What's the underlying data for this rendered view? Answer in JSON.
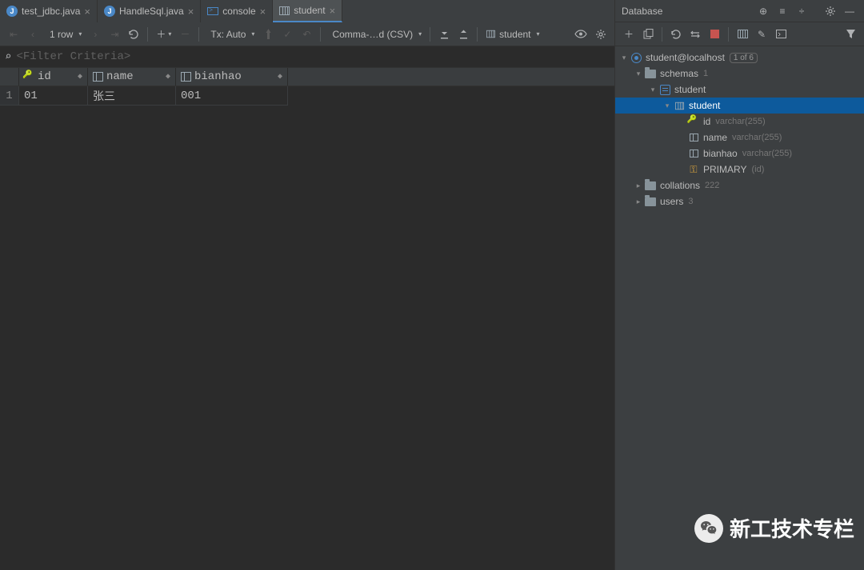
{
  "tabs": [
    {
      "label": "test_jdbc.java",
      "icon": "java"
    },
    {
      "label": "HandleSql.java",
      "icon": "java"
    },
    {
      "label": "console",
      "icon": "console"
    },
    {
      "label": "student",
      "icon": "table",
      "active": true
    }
  ],
  "toolbar": {
    "row_count": "1 row",
    "tx_mode": "Tx: Auto",
    "csv_mode": "Comma-…d (CSV)",
    "entity": "student"
  },
  "filter_placeholder": "<Filter Criteria>",
  "table": {
    "columns": [
      "id",
      "name",
      "bianhao"
    ],
    "rows": [
      {
        "n": "1",
        "id": "01",
        "name": "张三",
        "bianhao": "001"
      }
    ]
  },
  "database_panel": {
    "title": "Database",
    "datasource": "student@localhost",
    "datasource_badge": "1 of 6",
    "schemas": {
      "label": "schemas",
      "count": "1"
    },
    "db": "student",
    "table": "student",
    "columns": [
      {
        "name": "id",
        "type": "varchar(255)",
        "key": true
      },
      {
        "name": "name",
        "type": "varchar(255)"
      },
      {
        "name": "bianhao",
        "type": "varchar(255)"
      }
    ],
    "primary": {
      "label": "PRIMARY",
      "meta": "(id)"
    },
    "collations": {
      "label": "collations",
      "count": "222"
    },
    "users": {
      "label": "users",
      "count": "3"
    }
  },
  "watermark_text": "新工技术专栏"
}
